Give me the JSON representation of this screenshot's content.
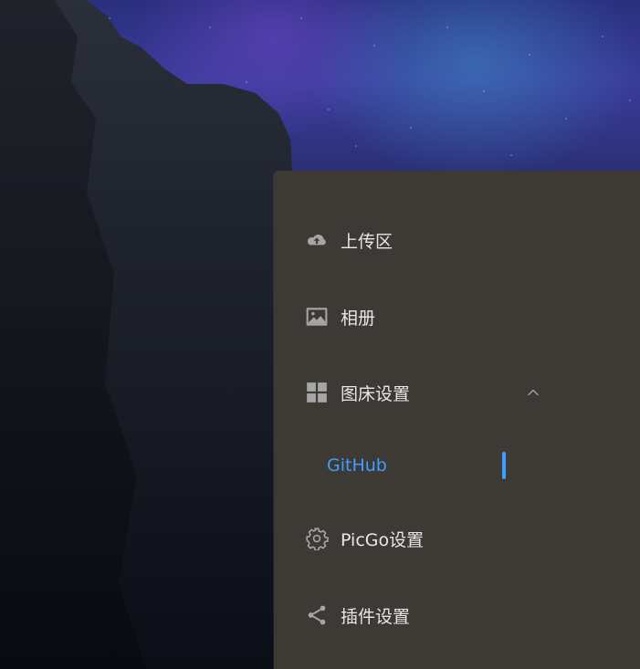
{
  "menu": {
    "items": [
      {
        "label": "上传区",
        "icon": "cloud-upload-icon"
      },
      {
        "label": "相册",
        "icon": "image-icon"
      },
      {
        "label": "图床设置",
        "icon": "grid-icon",
        "expanded": true
      },
      {
        "label": "PicGo设置",
        "icon": "gear-icon"
      },
      {
        "label": "插件设置",
        "icon": "share-icon"
      }
    ],
    "submenu": {
      "items": [
        {
          "label": "GitHub",
          "active": true
        }
      ]
    }
  },
  "colors": {
    "menu_bg": "#3d3a35",
    "text": "#e7e7e7",
    "icon": "#a6a6a6",
    "accent": "#409eff"
  }
}
